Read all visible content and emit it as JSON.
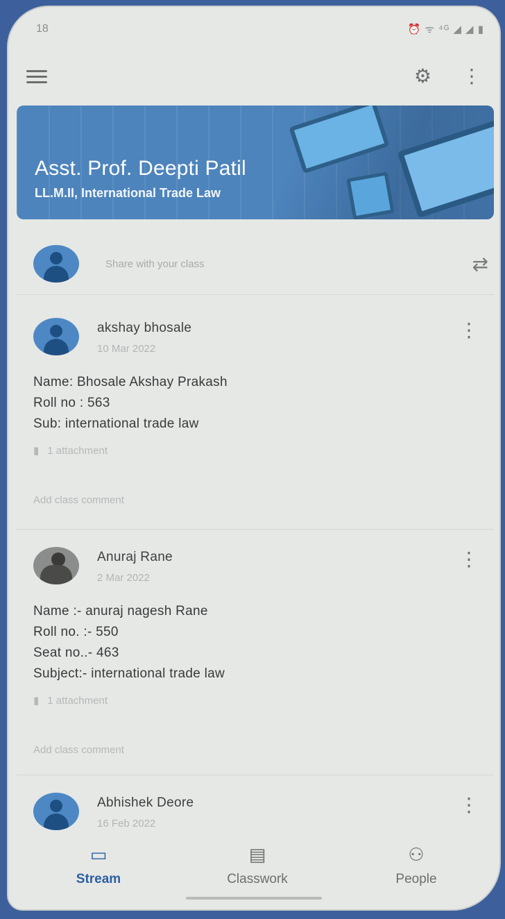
{
  "status_bar": {
    "time": "18",
    "icons": "⏰ ᯤ ⁴ᴳ ◢ ◢ ▮"
  },
  "top_bar": {
    "menu_icon": "menu-icon",
    "settings_icon": "gear-icon",
    "more_icon": "more-vert-icon"
  },
  "banner": {
    "title": "Asst. Prof. Deepti Patil",
    "subtitle": "LL.M.II, International Trade Law",
    "color": "#4d84bc"
  },
  "share": {
    "placeholder": "Share with your class"
  },
  "posts": [
    {
      "author": "akshay bhosale",
      "date": "10 Mar 2022",
      "lines": [
        "Name: Bhosale Akshay Prakash",
        "Roll no : 563",
        "Sub: international trade law"
      ],
      "attachment": "1 attachment",
      "comment": "Add class comment"
    },
    {
      "author": "Anuraj Rane",
      "date": "2 Mar 2022",
      "lines": [
        "Name :- anuraj nagesh Rane",
        "Roll no. :- 550",
        "Seat no..- 463",
        "Subject:- international trade law"
      ],
      "attachment": "1 attachment",
      "comment": "Add class comment"
    },
    {
      "author": "Abhishek Deore",
      "date": "16 Feb 2022"
    }
  ],
  "bottom_nav": [
    {
      "label": "Stream",
      "icon": "stream-icon",
      "active": true
    },
    {
      "label": "Classwork",
      "icon": "classwork-icon",
      "active": false
    },
    {
      "label": "People",
      "icon": "people-icon",
      "active": false
    }
  ],
  "accent_color": "#2d5fa0"
}
